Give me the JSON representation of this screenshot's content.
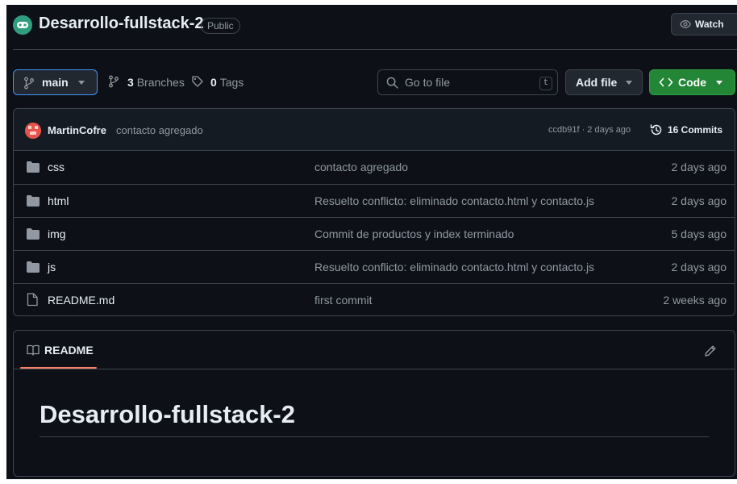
{
  "repo": {
    "name": "Desarrollo-fullstack-2",
    "visibility": "Public",
    "watch_label": "Watch"
  },
  "toolbar": {
    "branch": "main",
    "branches_count": "3",
    "branches_label": "Branches",
    "tags_count": "0",
    "tags_label": "Tags",
    "goto_placeholder": "Go to file",
    "goto_shortcut": "t",
    "add_file_label": "Add file",
    "code_label": "Code"
  },
  "latest_commit": {
    "author": "MartinCofre",
    "message": "contacto agregado",
    "hash_and_time": "ccdb91f · 2 days ago",
    "commits_label": "16 Commits"
  },
  "files": [
    {
      "name": "css",
      "type": "folder",
      "message": "contacto agregado",
      "time": "2 days ago"
    },
    {
      "name": "html",
      "type": "folder",
      "message": "Resuelto conflicto: eliminado contacto.html y contacto.js",
      "time": "2 days ago"
    },
    {
      "name": "img",
      "type": "folder",
      "message": "Commit de productos y index terminado",
      "time": "5 days ago"
    },
    {
      "name": "js",
      "type": "folder",
      "message": "Resuelto conflicto: eliminado contacto.html y contacto.js",
      "time": "2 days ago"
    },
    {
      "name": "README.md",
      "type": "file",
      "message": "first commit",
      "time": "2 weeks ago"
    }
  ],
  "readme": {
    "tab_label": "README",
    "heading": "Desarrollo-fullstack-2"
  },
  "colors": {
    "background": "#0d1117",
    "border": "#3d444d",
    "accent_blue": "#4493f8",
    "code_green": "#238636",
    "tab_underline": "#f78166"
  },
  "icons": {
    "branch": "git-branch-icon",
    "tag": "tag-icon",
    "search": "search-icon",
    "code": "code-icon",
    "history": "history-icon",
    "folder": "folder-icon",
    "file": "file-icon",
    "book": "book-icon",
    "pencil": "pencil-icon",
    "eye": "eye-icon"
  }
}
